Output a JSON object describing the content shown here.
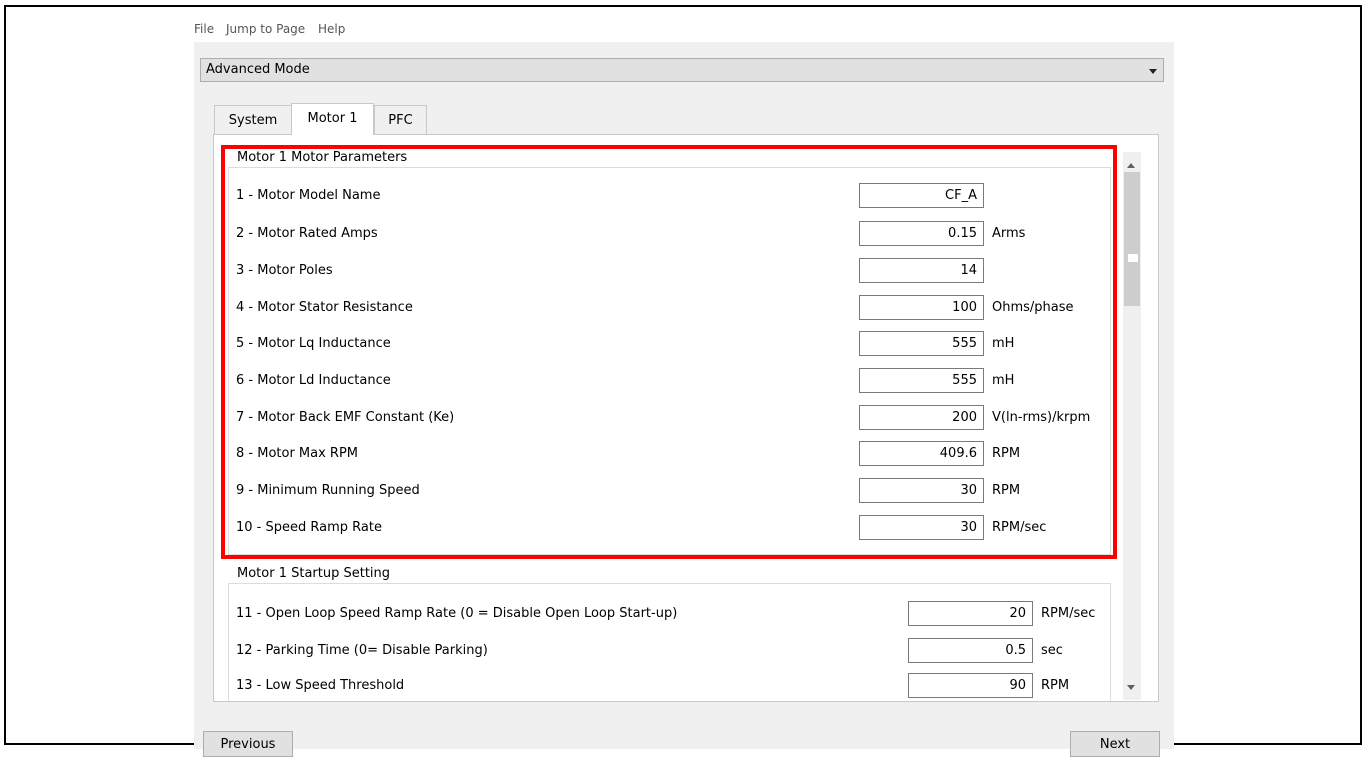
{
  "menu": [
    "File",
    "Jump to Page",
    "Help"
  ],
  "mode": "Advanced Mode",
  "tabs": [
    "System",
    "Motor 1",
    "PFC"
  ],
  "groups": {
    "motor_params": "Motor 1 Motor Parameters",
    "startup": "Motor 1 Startup Setting"
  },
  "motor_params": [
    {
      "label": "1 - Motor Model Name",
      "value": "CF_A",
      "unit": ""
    },
    {
      "label": "2 - Motor Rated Amps",
      "value": "0.15",
      "unit": "Arms"
    },
    {
      "label": "3 - Motor Poles",
      "value": "14",
      "unit": ""
    },
    {
      "label": "4 - Motor Stator Resistance",
      "value": "100",
      "unit": "Ohms/phase"
    },
    {
      "label": "5 - Motor Lq Inductance",
      "value": "555",
      "unit": "mH"
    },
    {
      "label": "6 - Motor Ld Inductance",
      "value": "555",
      "unit": "mH"
    },
    {
      "label": "7 - Motor Back EMF Constant (Ke)",
      "value": "200",
      "unit": "V(ln-rms)/krpm"
    },
    {
      "label": "8 - Motor Max RPM",
      "value": "409.6",
      "unit": "RPM"
    },
    {
      "label": "9 - Minimum Running Speed",
      "value": "30",
      "unit": "RPM"
    },
    {
      "label": "10 - Speed Ramp Rate",
      "value": "30",
      "unit": "RPM/sec"
    }
  ],
  "startup_params": [
    {
      "label": "11 - Open Loop Speed Ramp Rate (0 = Disable Open Loop Start-up)",
      "value": "20",
      "unit": "RPM/sec"
    },
    {
      "label": "12 - Parking Time (0= Disable Parking)",
      "value": "0.5",
      "unit": "sec"
    },
    {
      "label": "13 - Low Speed Threshold",
      "value": "90",
      "unit": "RPM"
    }
  ],
  "buttons": {
    "previous": "Previous",
    "next": "Next"
  },
  "highlight_color": "#ff0000"
}
